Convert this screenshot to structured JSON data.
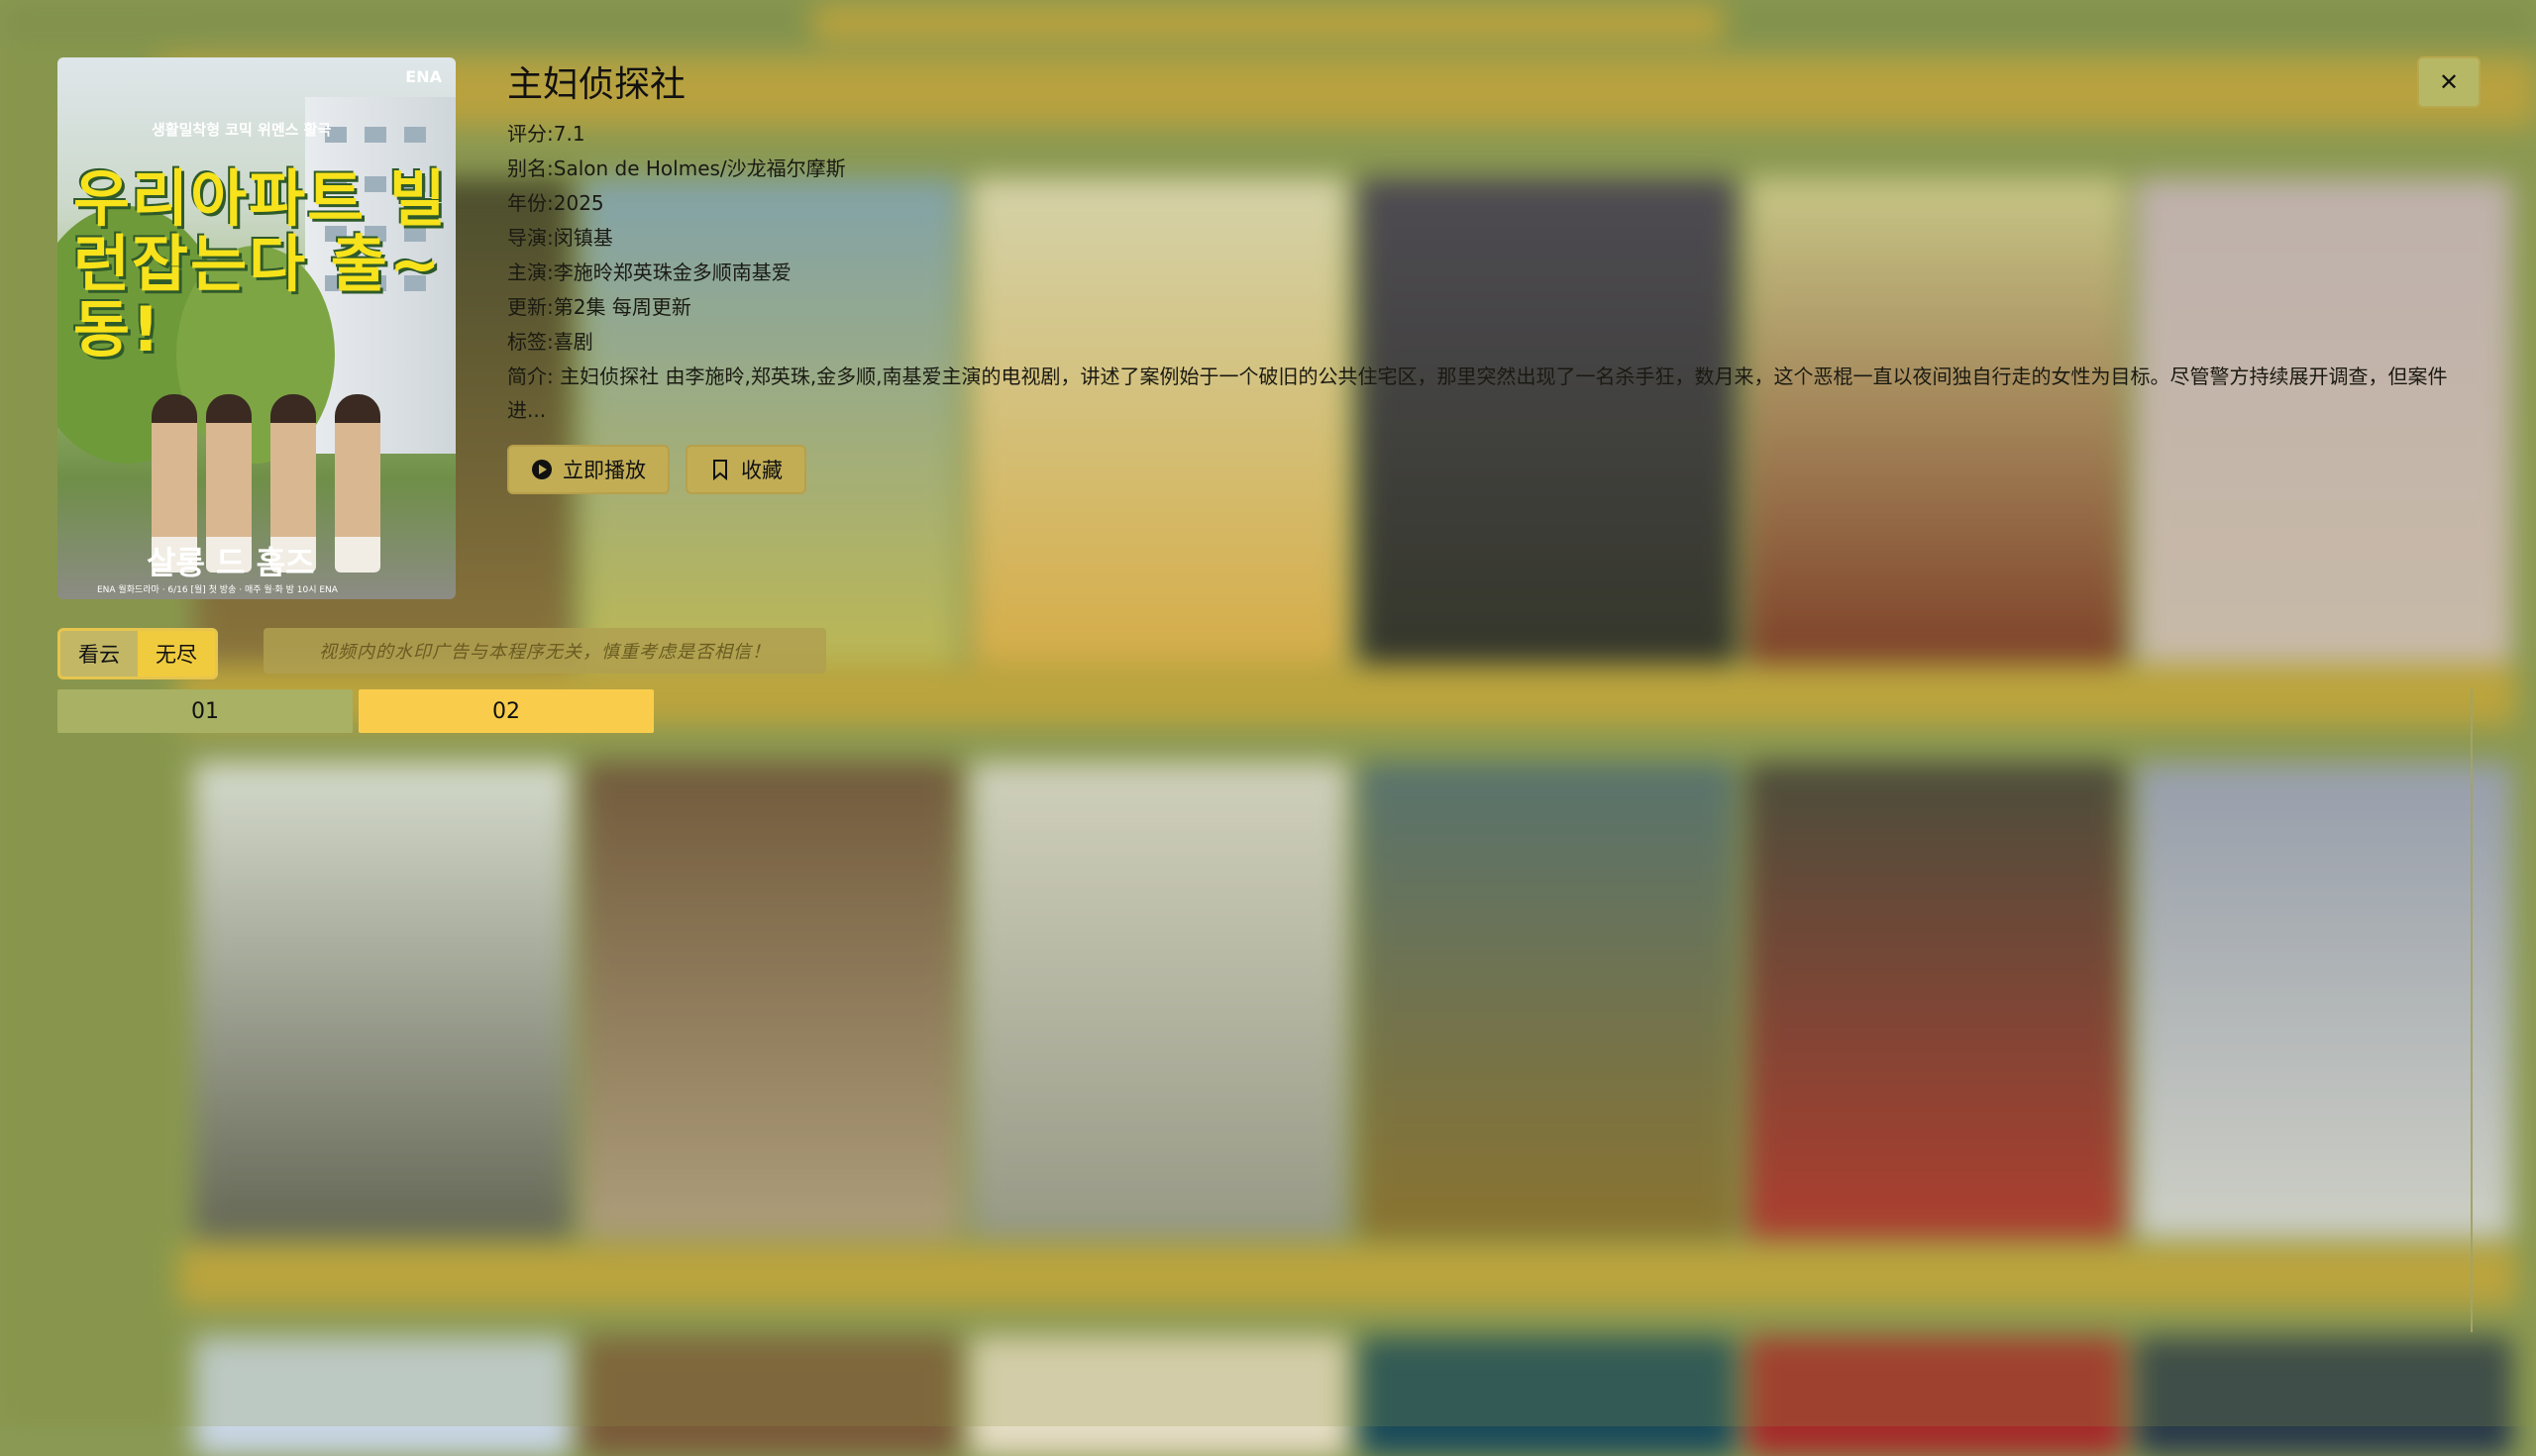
{
  "detail": {
    "title": "主妇侦探社",
    "rating_label": "评分:",
    "rating": "7.1",
    "alias_label": "别名:",
    "alias": "Salon de Holmes/沙龙福尔摩斯",
    "year_label": "年份:",
    "year": "2025",
    "director_label": "导演:",
    "director": "闵镇基",
    "cast_label": "主演:",
    "cast": "李施昤郑英珠金多顺南基爱",
    "update_label": "更新:",
    "update": "第2集 每周更新",
    "tags_label": "标签:",
    "tags": "喜剧",
    "summary_label": "简介: ",
    "summary": "主妇侦探社 由李施昤,郑英珠,金多顺,南基爱主演的电视剧，讲述了案例始于一个破旧的公共住宅区，那里突然出现了一名杀手狂，数月来，这个恶棍一直以夜间独自行走的女性为目标。尽管警方持续展开调查，但案件进..."
  },
  "poster": {
    "title_text": "우리아파트 빌런잡는다 출~동!",
    "tagline": "생활밀착형 코믹 위멘스 활극",
    "brand": "ENA",
    "bottom_logo": "살롱 드 홈즈",
    "fine_print": "ENA 월화드라마 · 6/16 [월] 첫 방송 · 매주 월·화 밤 10시 ENA"
  },
  "buttons": {
    "play_label": "立即播放",
    "play_icon": "play-circle-icon",
    "favorite_label": "收藏",
    "favorite_icon": "bookmark-icon",
    "close_symbol": "✕",
    "close_icon": "close-icon"
  },
  "sources": [
    "看云",
    "无尽"
  ],
  "notice": "视频内的水印广告与本程序无关，慎重考虑是否相信！",
  "episodes": [
    "01",
    "02"
  ],
  "colors": {
    "accent_yellow": "#f9cd4b",
    "episode_active": "#a8b164",
    "source_active": "#c3b766",
    "overlay_green": "#8b9a55"
  }
}
